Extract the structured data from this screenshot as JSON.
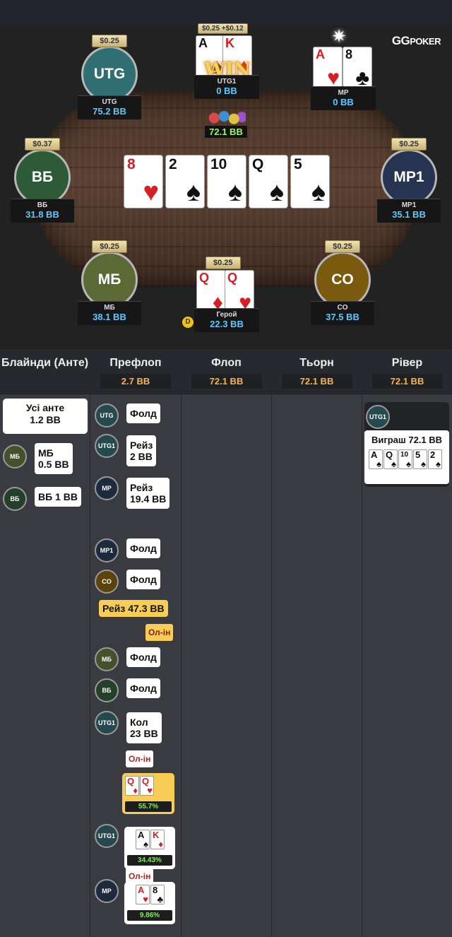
{
  "logo": {
    "brand": "GG",
    "sub": "POKER"
  },
  "table": {
    "pot": "72.1 BB",
    "win_text": "WIN",
    "seats": {
      "utg": {
        "bet": "$0.25",
        "avatar": "UTG",
        "name": "UTG",
        "stack": "75.2 BB"
      },
      "utg1": {
        "bet": "$0.25 +$0.12",
        "name": "UTG1",
        "stack": "0 BB"
      },
      "mp": {
        "name": "MP",
        "stack": "0 BB"
      },
      "bb": {
        "bet": "$0.37",
        "avatar": "ВБ",
        "name": "ВБ",
        "stack": "31.8 BB"
      },
      "mp1": {
        "bet": "$0.25",
        "avatar": "MP1",
        "name": "MP1",
        "stack": "35.1 BB"
      },
      "sb": {
        "bet": "$0.25",
        "avatar": "МБ",
        "name": "МБ",
        "stack": "38.1 BB"
      },
      "hero": {
        "bet": "$0.25",
        "name": "Герой",
        "stack": "22.3 BB"
      },
      "co": {
        "bet": "$0.25",
        "avatar": "CO",
        "name": "CO",
        "stack": "37.5 BB"
      }
    },
    "dealer": "D",
    "board": [
      {
        "rank": "8",
        "suit": "♥",
        "color": "#d81d23"
      },
      {
        "rank": "2",
        "suit": "♠",
        "color": "#111111"
      },
      {
        "rank": "10",
        "suit": "♠",
        "color": "#111111"
      },
      {
        "rank": "Q",
        "suit": "♠",
        "color": "#111111"
      },
      {
        "rank": "5",
        "suit": "♠",
        "color": "#111111"
      }
    ],
    "utg1_cards": [
      {
        "rank": "A",
        "suit": "♠"
      },
      {
        "rank": "K",
        "suit": "♦"
      }
    ],
    "mp_cards": [
      {
        "rank": "A",
        "suit": "♥"
      },
      {
        "rank": "8",
        "suit": "♣"
      }
    ],
    "hero_cards": [
      {
        "rank": "Q",
        "suit": "♦"
      },
      {
        "rank": "Q",
        "suit": "♥"
      }
    ]
  },
  "history": {
    "columns": [
      {
        "title": "Блайнди (Анте)",
        "pot": ""
      },
      {
        "title": "Префлоп",
        "pot": "2.7 BB"
      },
      {
        "title": "Флоп",
        "pot": "72.1 BB"
      },
      {
        "title": "Тьорн",
        "pot": "72.1 BB"
      },
      {
        "title": "Рівер",
        "pot": "72.1 BB"
      }
    ],
    "blinds": {
      "ante_line1": "Усі анте",
      "ante_line2": "1.2 BB",
      "sb_badge": "МБ",
      "sb_line1": "МБ",
      "sb_line2": "0.5 BB",
      "bb_badge": "ВБ",
      "bb_text": "ВБ 1 BB"
    },
    "preflop": {
      "a1_badge": "UTG",
      "a1": "Фолд",
      "a2_badge": "UTG1",
      "a2_l1": "Рейз",
      "a2_l2": "2 BB",
      "a3_badge": "MP",
      "a3_l1": "Рейз",
      "a3_l2": "19.4 BB",
      "a3_allin": "Ол-ін",
      "a4_badge": "MP1",
      "a4": "Фолд",
      "a5_badge": "CO",
      "a5": "Фолд",
      "hero_raise": "Рейз 47.3 BB",
      "hero_allin": "Ол-ін",
      "a6_badge": "МБ",
      "a6": "Фолд",
      "a7_badge": "ВБ",
      "a7": "Фолд",
      "a8_badge": "UTG1",
      "a8_l1": "Кол",
      "a8_l2": "23 BB",
      "a8_allin": "Ол-ін",
      "hero_equity": "55.7%",
      "utg1_badge": "UTG1",
      "utg1_equity": "34.43%",
      "mp_badge": "MP",
      "mp_equity": "9.86%"
    },
    "river": {
      "badge": "UTG1",
      "win_text": "Виграш 72.1 BB",
      "cards": [
        {
          "rank": "A",
          "suit": "♠"
        },
        {
          "rank": "Q",
          "suit": "♠"
        },
        {
          "rank": "10",
          "suit": "♠"
        },
        {
          "rank": "5",
          "suit": "♠"
        },
        {
          "rank": "2",
          "suit": "♠"
        }
      ]
    }
  }
}
